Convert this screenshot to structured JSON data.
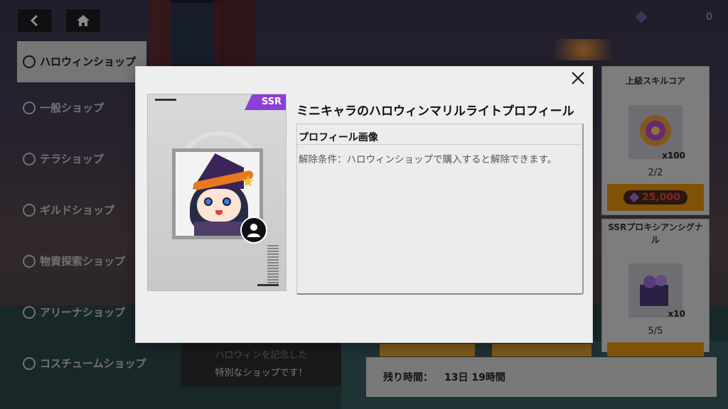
{
  "currency": {
    "icon": "gem-icon",
    "amount": "0"
  },
  "nav": {
    "back_icon": "back-arrow-icon",
    "home_icon": "home-icon"
  },
  "sidebar": {
    "items": [
      {
        "label": "ハロウィンショップ",
        "icon": "pumpkin-icon",
        "active": true
      },
      {
        "label": "一般ショップ",
        "icon": "bag-icon",
        "active": false
      },
      {
        "label": "テラショップ",
        "icon": "coin-icon",
        "active": false
      },
      {
        "label": "ギルドショップ",
        "icon": "guild-icon",
        "active": false
      },
      {
        "label": "物資探索ショップ",
        "icon": "compass-icon",
        "active": false
      },
      {
        "label": "アリーナショップ",
        "icon": "arena-icon",
        "active": false
      },
      {
        "label": "コスチュームショップ",
        "icon": "shirt-icon",
        "active": false
      }
    ]
  },
  "shop_description": {
    "line1": "ハロウィンを記念した",
    "line2": "特別なショップです！"
  },
  "remaining": {
    "label": "残り時間：",
    "value": "13日 19時間"
  },
  "right_cards": [
    {
      "title": "上級スキルコア",
      "qty": "x100",
      "count": "2/2",
      "price": "25,000"
    },
    {
      "title": "SSRプロキシアンシグナル",
      "qty": "x10",
      "count": "5/5",
      "price": ""
    }
  ],
  "modal": {
    "rarity": "SSR",
    "title": "ミニキャラのハロウィンマリルライトプロフィール",
    "type_label": "プロフィール画像",
    "condition": "解除条件：ハロウィンショップで購入すると解除できます。",
    "close_icon": "close-icon"
  }
}
